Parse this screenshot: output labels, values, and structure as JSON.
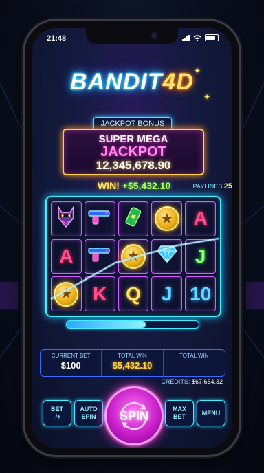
{
  "status": {
    "time": "21:48"
  },
  "logo": {
    "main": "BANDIT",
    "accent": "4D"
  },
  "jackpot": {
    "label": "JACKPOT BONUS",
    "line1": "SUPER MEGA",
    "line2": "JACKPOT",
    "amount": "12,345,678.90"
  },
  "win": {
    "label": "WIN!",
    "amount": "+$5,432.10"
  },
  "paylines": {
    "label": "PAYLINES",
    "value": "25"
  },
  "reels": [
    [
      {
        "sym": "bandit",
        "icon": "bandit-icon"
      },
      {
        "sym": "gun",
        "icon": "pistol-icon"
      },
      {
        "sym": "battery",
        "icon": "battery-icon"
      },
      {
        "sym": "coin",
        "icon": "star-coin-icon"
      },
      {
        "sym": "A",
        "color": "red"
      }
    ],
    [
      {
        "sym": "A",
        "color": "red"
      },
      {
        "sym": "gun",
        "icon": "pistol-icon"
      },
      {
        "sym": "coin",
        "icon": "star-coin-icon"
      },
      {
        "sym": "diamond",
        "icon": "diamond-icon"
      },
      {
        "sym": "J",
        "color": "green"
      }
    ],
    [
      {
        "sym": "coin",
        "icon": "star-coin-icon"
      },
      {
        "sym": "K",
        "color": "red"
      },
      {
        "sym": "Q",
        "color": "yellow"
      },
      {
        "sym": "J",
        "color": "blue"
      },
      {
        "sym": "10",
        "color": "blue"
      }
    ]
  ],
  "progress": {
    "fraction": 0.6
  },
  "bet_panel": {
    "current_bet_label": "CURRENT BET",
    "current_bet": "$100",
    "total_win_label": "TOTAL WIN",
    "total_win": "$5,432.10",
    "total_win2_label": "TOTAL WIN",
    "total_win2": ""
  },
  "credits": {
    "label": "CREDITS:",
    "value": "$67,654.32"
  },
  "buttons": {
    "bet_line1": "BET",
    "bet_line2": "-/+",
    "auto_line1": "AUTO",
    "auto_line2": "SPIN",
    "spin": "SPIN",
    "max_line1": "MAX",
    "max_line2": "BET",
    "menu": "MENU"
  },
  "colors": {
    "accent_cyan": "#44f0ff",
    "accent_magenta": "#d35cff",
    "gold": "#ffd34a"
  }
}
